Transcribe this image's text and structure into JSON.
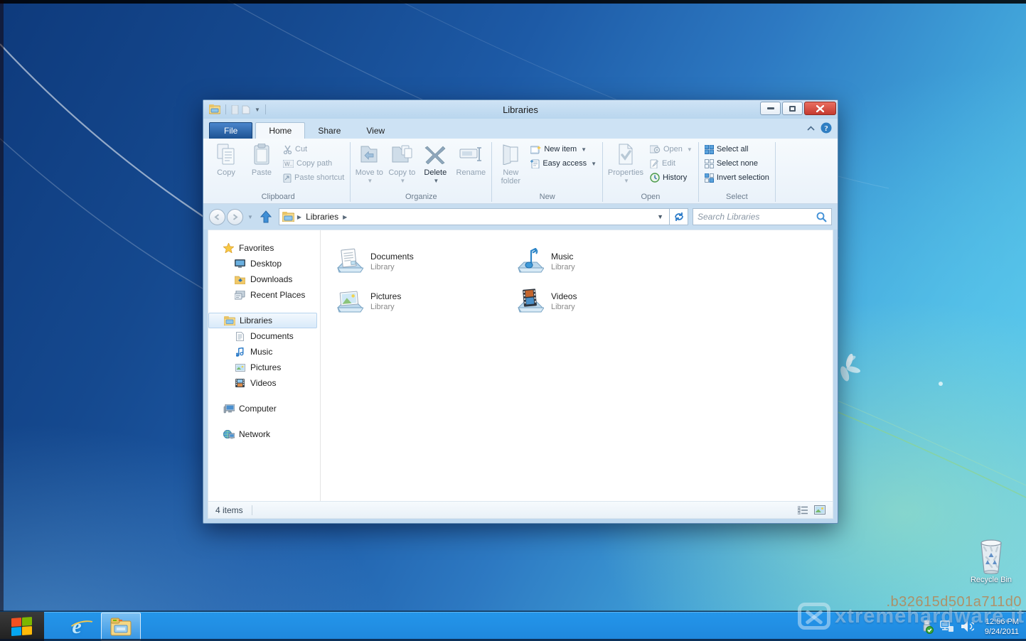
{
  "window": {
    "title": "Libraries",
    "tabs": {
      "file": "File",
      "home": "Home",
      "share": "Share",
      "view": "View"
    },
    "ribbon": {
      "clipboard": {
        "label": "Clipboard",
        "copy": "Copy",
        "paste": "Paste",
        "cut": "Cut",
        "copy_path": "Copy path",
        "paste_shortcut": "Paste shortcut"
      },
      "organize": {
        "label": "Organize",
        "move_to": "Move to",
        "copy_to": "Copy to",
        "delete": "Delete",
        "rename": "Rename"
      },
      "new_group": {
        "label": "New",
        "new_folder": "New folder",
        "new_item": "New item",
        "easy_access": "Easy access"
      },
      "open_group": {
        "label": "Open",
        "properties": "Properties",
        "open": "Open",
        "edit": "Edit",
        "history": "History"
      },
      "select_group": {
        "label": "Select",
        "select_all": "Select all",
        "select_none": "Select none",
        "invert_selection": "Invert selection"
      }
    },
    "navbar": {
      "breadcrumb_root": "Libraries",
      "search_placeholder": "Search Libraries"
    },
    "sidebar": {
      "favorites_label": "Favorites",
      "favorites": [
        {
          "label": "Desktop"
        },
        {
          "label": "Downloads"
        },
        {
          "label": "Recent Places"
        }
      ],
      "libraries_label": "Libraries",
      "libraries": [
        {
          "label": "Documents"
        },
        {
          "label": "Music"
        },
        {
          "label": "Pictures"
        },
        {
          "label": "Videos"
        }
      ],
      "computer_label": "Computer",
      "network_label": "Network"
    },
    "content": {
      "items": [
        {
          "name": "Documents",
          "type": "Library"
        },
        {
          "name": "Music",
          "type": "Library"
        },
        {
          "name": "Pictures",
          "type": "Library"
        },
        {
          "name": "Videos",
          "type": "Library"
        }
      ]
    },
    "statusbar": {
      "items_count": "4 items"
    }
  },
  "taskbar": {
    "clock_time": "12:56 PM",
    "clock_date": "9/24/2011"
  },
  "desktop": {
    "recycle_bin_label": "Recycle Bin",
    "build_watermark": ".b32615d501a711d0",
    "photo_watermark": "xtremehardware.it"
  },
  "colors": {
    "accent_blue": "#2b63ad",
    "taskbar_blue": "#2196e8",
    "close_red": "#c53a30",
    "selection_blue": "#d9eafa",
    "desktop_navy": "#15498f",
    "desktop_cyan": "#54c0e5"
  }
}
